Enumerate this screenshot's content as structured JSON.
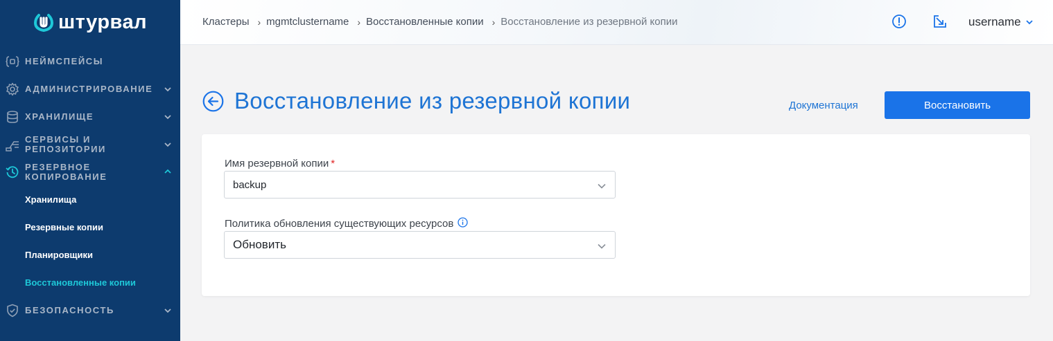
{
  "app": {
    "logo_text": "штурвал"
  },
  "sidebar": {
    "items": [
      {
        "label": "Неймспейсы",
        "icon": "namespace-icon",
        "has_chevron": false
      },
      {
        "label": "Администрирование",
        "icon": "gear-icon",
        "has_chevron": true
      },
      {
        "label": "Хранилище",
        "icon": "database-icon",
        "has_chevron": true
      },
      {
        "label": "Сервисы и репозитории",
        "icon": "services-icon",
        "has_chevron": true
      },
      {
        "label": "Резервное копирование",
        "icon": "backup-clock-icon",
        "has_chevron": true,
        "expanded": true
      },
      {
        "label": "Безопасность",
        "icon": "shield-icon",
        "has_chevron": true
      }
    ],
    "sub_items": [
      {
        "label": "Хранилища"
      },
      {
        "label": "Резервные копии"
      },
      {
        "label": "Планировщики"
      },
      {
        "label": "Восстановленные копии",
        "current": true
      }
    ],
    "colors": {
      "background": "#0d3b6e",
      "accent": "#1ec8d8"
    }
  },
  "header": {
    "breadcrumb": [
      "Кластеры",
      "mgmtclustername",
      "Восстановленные копии",
      "Восстановление из резервной копии"
    ],
    "username": "username"
  },
  "main": {
    "title": "Восстановление из резервной копии",
    "doc_link": "Документация",
    "submit_label": "Восстановить",
    "form": {
      "backup_name_label": "Имя резервной копии",
      "backup_name_required": "*",
      "backup_name_value": "backup",
      "policy_label": "Политика обновления существующих ресурсов",
      "policy_value": "Обновить"
    },
    "colors": {
      "primary": "#1a73e8",
      "title": "#1e74d4"
    }
  }
}
